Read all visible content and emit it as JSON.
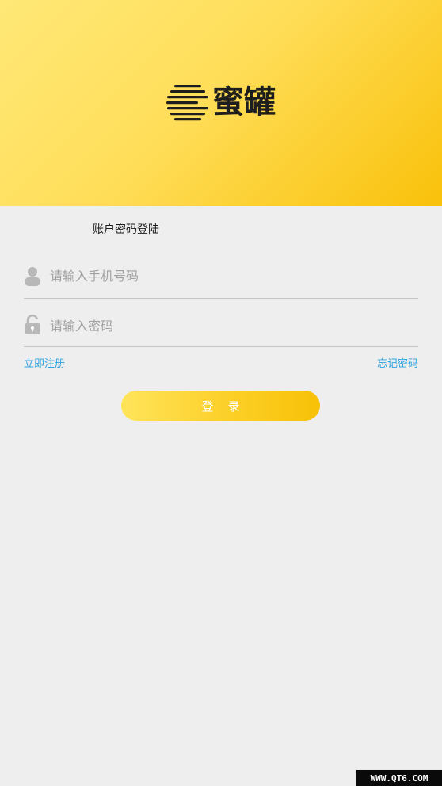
{
  "header": {
    "logo_text": "蜜罐",
    "logo_icon": "honeypot-lines-icon",
    "gradient_start": "#ffe877",
    "gradient_end": "#f9c10a"
  },
  "login": {
    "subtitle": "账户密码登陆",
    "phone_placeholder": "请输入手机号码",
    "phone_value": "",
    "phone_icon": "user-icon",
    "password_placeholder": "请输入密码",
    "password_value": "",
    "password_icon": "unlock-icon",
    "register_link": "立即注册",
    "forgot_link": "忘记密码",
    "submit_label": "登录",
    "link_color": "#2ba3e0"
  },
  "watermark": {
    "text": "WWW.QT6.COM"
  }
}
